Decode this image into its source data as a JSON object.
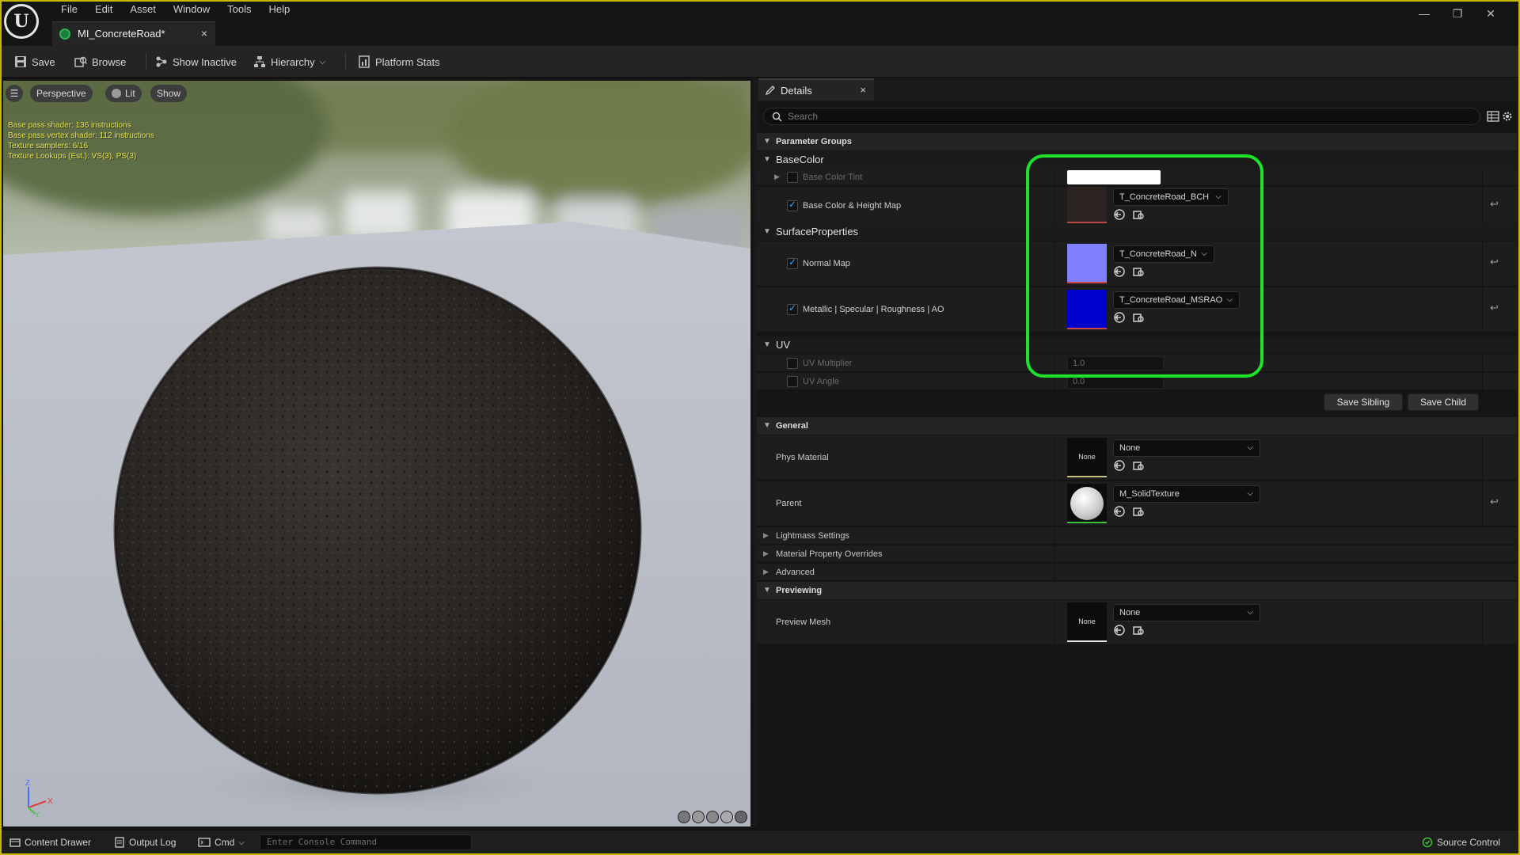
{
  "menu": [
    "File",
    "Edit",
    "Asset",
    "Window",
    "Tools",
    "Help"
  ],
  "window_controls": {
    "minimize": "—",
    "restore": "❐",
    "close": "✕"
  },
  "doc_tab": {
    "title": "MI_ConcreteRoad*",
    "close": "×"
  },
  "toolbar": {
    "save": "Save",
    "browse": "Browse",
    "show_inactive": "Show Inactive",
    "hierarchy": "Hierarchy",
    "platform_stats": "Platform Stats"
  },
  "viewport": {
    "perspective": "Perspective",
    "lit": "Lit",
    "show": "Show",
    "stats": [
      "Base pass shader: 136 instructions",
      "Base pass vertex shader: 112 instructions",
      "Texture samplers: 6/16",
      "Texture Lookups (Est.): VS(3), PS(3)"
    ],
    "axis": {
      "z": "Z",
      "x": "X",
      "y": "Y"
    }
  },
  "details": {
    "tab_title": "Details",
    "tab_close": "×",
    "search_placeholder": "Search",
    "parameter_groups": "Parameter Groups",
    "base_color": {
      "section": "BaseColor",
      "tint_label": "Base Color Tint",
      "map_label": "Base Color & Height Map",
      "map_texture": "T_ConcreteRoad_BCH",
      "tint_color": "#ffffff"
    },
    "surface": {
      "section": "SurfaceProperties",
      "normal_label": "Normal Map",
      "normal_texture": "T_ConcreteRoad_N",
      "normal_color": "#8080ff",
      "msrao_label": "Metallic | Specular | Roughness | AO",
      "msrao_texture": "T_ConcreteRoad_MSRAO",
      "msrao_color": "#0000cc"
    },
    "uv": {
      "section": "UV",
      "multiplier_label": "UV Multiplier",
      "multiplier_value": "1.0",
      "angle_label": "UV Angle",
      "angle_value": "0.0"
    },
    "buttons": {
      "save_sibling": "Save Sibling",
      "save_child": "Save Child"
    },
    "general": {
      "section": "General",
      "phys_label": "Phys Material",
      "phys_thumb": "None",
      "phys_value": "None",
      "parent_label": "Parent",
      "parent_value": "M_SolidTexture"
    },
    "collapsed": [
      "Lightmass Settings",
      "Material Property Overrides",
      "Advanced"
    ],
    "previewing": {
      "section": "Previewing",
      "mesh_label": "Preview Mesh",
      "mesh_thumb": "None",
      "mesh_value": "None"
    }
  },
  "statusbar": {
    "content_drawer": "Content Drawer",
    "output_log": "Output Log",
    "cmd": "Cmd",
    "console_placeholder": "Enter Console Command",
    "source_control": "Source Control"
  },
  "colors": {
    "highlight": "#1fe22a",
    "frame": "#c9b800",
    "accent_check": "#3aa3ff"
  }
}
